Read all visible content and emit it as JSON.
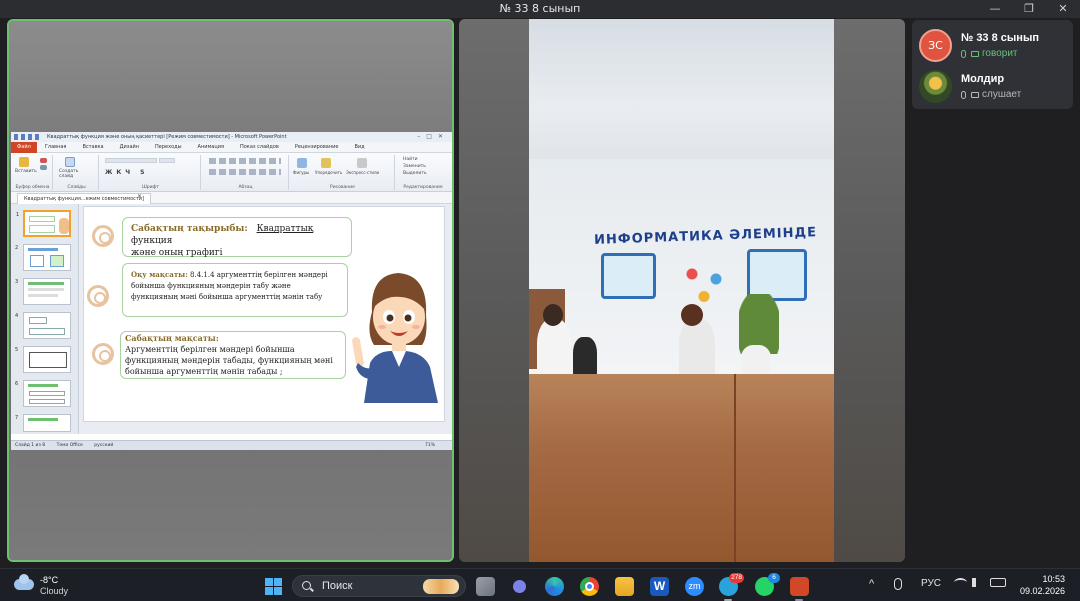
{
  "window": {
    "title": "№ 33 8 сынып",
    "minimize_glyph": "—",
    "restore_glyph": "❐",
    "close_glyph": "✕"
  },
  "screen_share": {
    "ppt_window_title": "Квадраттық функция және оның қасиеттері [Режим совместимости] - Microsoft PowerPoint",
    "ribbon_tabs": [
      "Файл",
      "Главная",
      "Вставка",
      "Дизайн",
      "Переходы",
      "Анимация",
      "Показ слайдов",
      "Рецензирование",
      "Вид"
    ],
    "ribbon_groups": [
      "Буфер обмена",
      "Слайды",
      "Шрифт",
      "Абзац",
      "Рисование",
      "Редактирование"
    ],
    "ribbon_buttons": {
      "paste": "Вставить",
      "new_slide": "Создать слайд",
      "shapes": "Фигуры",
      "arrange": "Упорядочить",
      "quick_styles": "Экспресс-стили",
      "find": "Найти",
      "replace": "Заменить",
      "select": "Выделить"
    },
    "doc_tab": "Квадраттық функция...ежим совместимости]",
    "thumb_numbers": [
      "1",
      "2",
      "3",
      "4",
      "5",
      "6",
      "7"
    ],
    "slide": {
      "box1_label": "Сабақтың тақырыбы:",
      "box1_topic": "Квадраттық",
      "box1_text": "функция",
      "box1_line2": "және оның графигі",
      "box2_label": "Оқу мақсаты:",
      "box2_text": "8.4.1.4 аргументтің берілген мәндері бойынша функцияның мәндерін табу және функцияның мәні бойынша аргументтің мәнін табу",
      "box3_label": "Сабақтың мақсаты:",
      "box3_text": "Аргументтің берілген мәндері бойынша функцияның мәндерін табады, функцияның мәні бойынша аргументтің мәнін табады ;"
    },
    "status_bar": {
      "slide_info": "Слайд 1 из 8",
      "theme": "Тема Office",
      "language": "русский",
      "zoom": "71%"
    }
  },
  "video": {
    "banner": "ИНФОРМАТИКА ӘЛЕМІНДЕ"
  },
  "participants": [
    {
      "initials": "ЗС",
      "name": "№ 33 8 сынып",
      "status": "говорит",
      "state": "speaking",
      "color": "#e0533f"
    },
    {
      "initials": "",
      "name": "Молдир",
      "status": "слушает",
      "state": "listening",
      "color": "#68c27a"
    }
  ],
  "taskbar": {
    "weather_temp": "-8°C",
    "weather_condition": "Cloudy",
    "search_placeholder": "Поиск",
    "telegram_badge": "278",
    "whatsapp_badge": "6",
    "word_label": "W",
    "zoom_label": "zm",
    "tray_caret": "^",
    "language": "РУС",
    "time": "10:53",
    "date": "09.02.2026"
  },
  "colors": {
    "active_border": "#6fbf73",
    "speaking": "#68c27a",
    "listening": "#b5b8bd",
    "badge_red": "#e53935",
    "badge_blue": "#1e88e5"
  }
}
